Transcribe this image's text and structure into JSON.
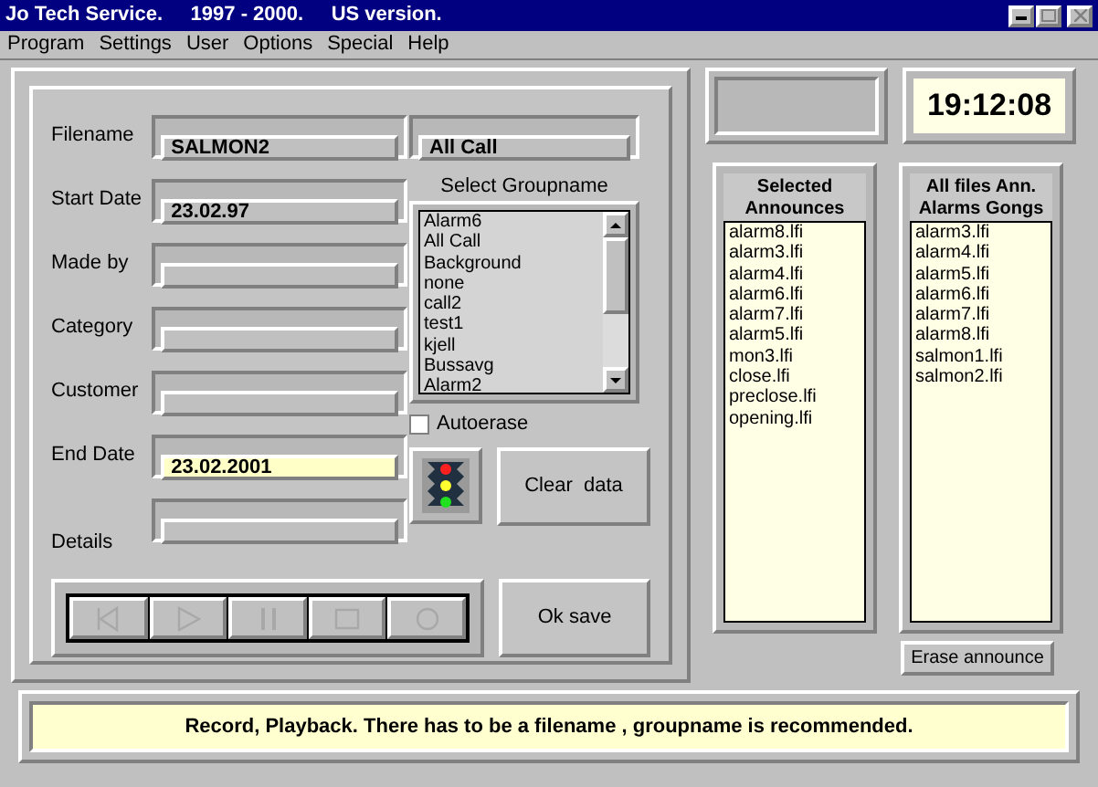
{
  "window": {
    "title": "Jo Tech Service.     1997 - 2000.     US version."
  },
  "menu": [
    "Program",
    "Settings",
    "User",
    "Options",
    "Special",
    "Help"
  ],
  "form": {
    "fields": [
      {
        "label": "Filename",
        "value": "SALMON2",
        "focused": false
      },
      {
        "label": "Start Date",
        "value": "23.02.97",
        "focused": false
      },
      {
        "label": "Made by",
        "focused": false
      },
      {
        "label": "Category",
        "focused": false
      },
      {
        "label": "Customer",
        "focused": false
      },
      {
        "label": "End Date",
        "value": "23.02.2001",
        "focused": true
      },
      {
        "label": "Details",
        "focused": false
      }
    ],
    "group_field": "All Call",
    "group_list": {
      "label": "Select Groupname",
      "items": [
        "Alarm6",
        "All Call",
        "Background",
        "none",
        "call2",
        "test1",
        "kjell",
        "Bussavg",
        "Alarm2"
      ]
    },
    "autoerase": {
      "label": "Autoerase",
      "checked": false
    },
    "clear_button": "Clear  data",
    "save_button": "Ok save",
    "media_buttons": [
      {
        "kind": "first",
        "disabled": true
      },
      {
        "kind": "play",
        "disabled": true
      },
      {
        "kind": "pause",
        "disabled": true
      },
      {
        "kind": "stop",
        "disabled": true
      },
      {
        "kind": "record",
        "disabled": true
      }
    ]
  },
  "clock": "19:12:08",
  "selected_announces": {
    "title": "Selected Announces",
    "items": [
      "alarm8.lfi",
      "alarm3.lfi",
      "alarm4.lfi",
      "alarm6.lfi",
      "alarm7.lfi",
      "alarm5.lfi",
      "mon3.lfi",
      "close.lfi",
      "preclose.lfi",
      "opening.lfi"
    ]
  },
  "all_files": {
    "title": "All files Ann. Alarms Gongs",
    "items": [
      "alarm3.lfi",
      "alarm4.lfi",
      "alarm5.lfi",
      "alarm6.lfi",
      "alarm7.lfi",
      "alarm8.lfi",
      "salmon1.lfi",
      "salmon2.lfi"
    ]
  },
  "erase_button": "Erase announce",
  "status_bar": "Record, Playback. There has to be a filename , groupname is recommended."
}
